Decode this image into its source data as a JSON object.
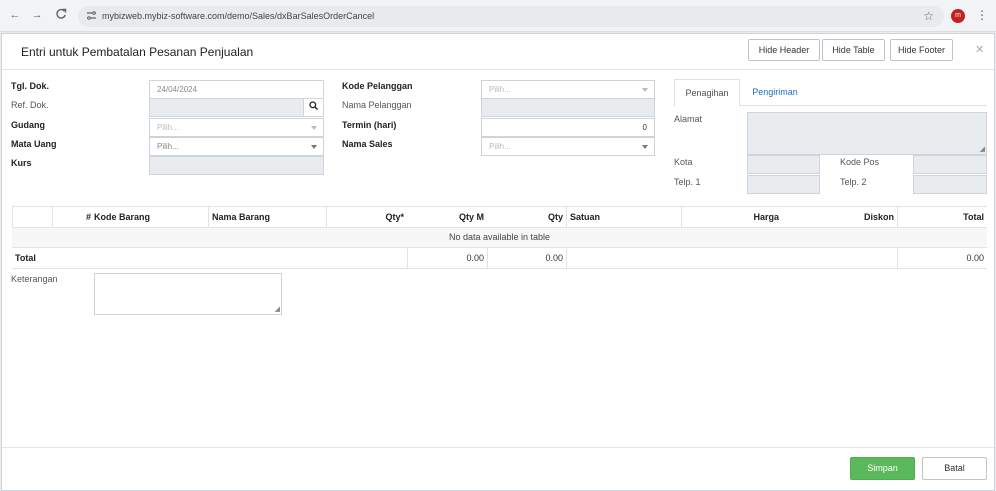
{
  "browser": {
    "back_icon": "←",
    "forward_icon": "→",
    "reload_icon": "C",
    "url": "mybizweb.mybiz-software.com/demo/Sales/dxBarSalesOrderCancel",
    "profile_initial": "m"
  },
  "modal": {
    "title": "Entri untuk Pembatalan Pesanan Penjualan",
    "hide_header": "Hide Header",
    "hide_table": "Hide Table",
    "hide_footer": "Hide Footer"
  },
  "form": {
    "tgl_dok": {
      "label": "Tgl. Dok.",
      "value": "24/04/2024"
    },
    "ref_dok": {
      "label": "Ref. Dok.",
      "value": ""
    },
    "gudang": {
      "label": "Gudang",
      "placeholder": "Pilih..."
    },
    "mata_uang": {
      "label": "Mata Uang",
      "placeholder": "Pilih..."
    },
    "kurs": {
      "label": "Kurs",
      "value": ""
    },
    "kode_pelanggan": {
      "label": "Kode Pelanggan",
      "placeholder": "Pilih..."
    },
    "nama_pelanggan": {
      "label": "Nama Pelanggan",
      "value": ""
    },
    "termin": {
      "label": "Termin (hari)",
      "value": "0"
    },
    "nama_sales": {
      "label": "Nama Sales",
      "placeholder": "Pilih..."
    }
  },
  "address": {
    "tabs": [
      "Penagihan",
      "Pengiriman"
    ],
    "alamat_label": "Alamat",
    "kota_label": "Kota",
    "kode_pos_label": "Kode Pos",
    "telp1_label": "Telp. 1",
    "telp2_label": "Telp. 2"
  },
  "table": {
    "columns": [
      "#",
      "Kode Barang",
      "Nama Barang",
      "Qty*",
      "Qty M",
      "Qty",
      "Satuan",
      "Harga",
      "Diskon",
      "Total"
    ],
    "empty_message": "No data available in table",
    "total_row": {
      "label": "Total",
      "qty_m": "0.00",
      "qty": "0.00",
      "total": "0.00"
    }
  },
  "footer": {
    "keterangan_label": "Keterangan",
    "save_label": "Simpan",
    "cancel_label": "Batal"
  },
  "colors": {
    "accent_link": "#1d6fb8",
    "save_button": "#5cb85c",
    "readonly_field": "#e9ecef"
  }
}
